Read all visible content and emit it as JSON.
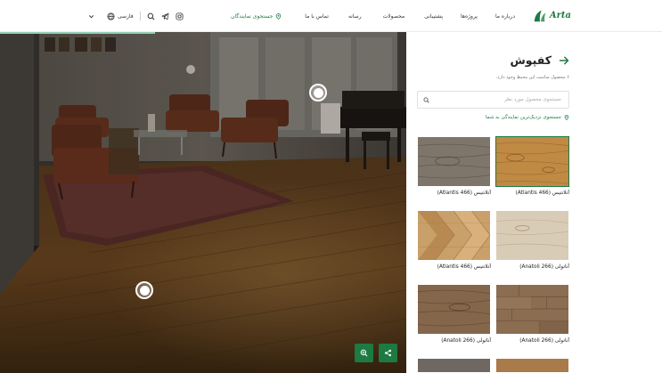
{
  "brand": {
    "name": "Arta"
  },
  "nav": {
    "about": "درباره ما",
    "projects": "پروژه‌ها",
    "support": "پشتیبانی",
    "products": "محصولات",
    "media": "رسانه",
    "contact": "تماس با ما",
    "find_dealers": "جستجوی نمایندگان"
  },
  "tools": {
    "language": "فارسی"
  },
  "panel": {
    "title": "کفپوش",
    "subtitle": "۶ محصول مناسب این محیط وجود دارد.",
    "search_placeholder": "جستجوی محصول مورد نظر",
    "nearest_dealer": "جستجوی نزدیک‌ترین نمایندگی به شما"
  },
  "products": [
    {
      "name": "آتلانتیس (Atlantis 466)",
      "selected": true
    },
    {
      "name": "آتلانتیس (Atlantis 466)",
      "selected": false
    },
    {
      "name": "آناتولی (Anatoli 266)",
      "selected": false
    },
    {
      "name": "آتلانتیس (Atlantis 466)",
      "selected": false
    },
    {
      "name": "آناتولی (Anatoli 266)",
      "selected": false
    },
    {
      "name": "آناتولی (Anatoli 266)",
      "selected": false
    }
  ],
  "colors": {
    "accent": "#1e7a43",
    "progress": "#8fd0b6"
  },
  "icons": {
    "zoom": "zoom-in-icon",
    "share": "share-icon",
    "search": "search-icon",
    "location": "location-pin-icon",
    "back": "arrow-right-icon",
    "instagram": "instagram-icon",
    "telegram": "telegram-icon",
    "globe": "globe-icon",
    "chevron": "chevron-down-icon"
  }
}
